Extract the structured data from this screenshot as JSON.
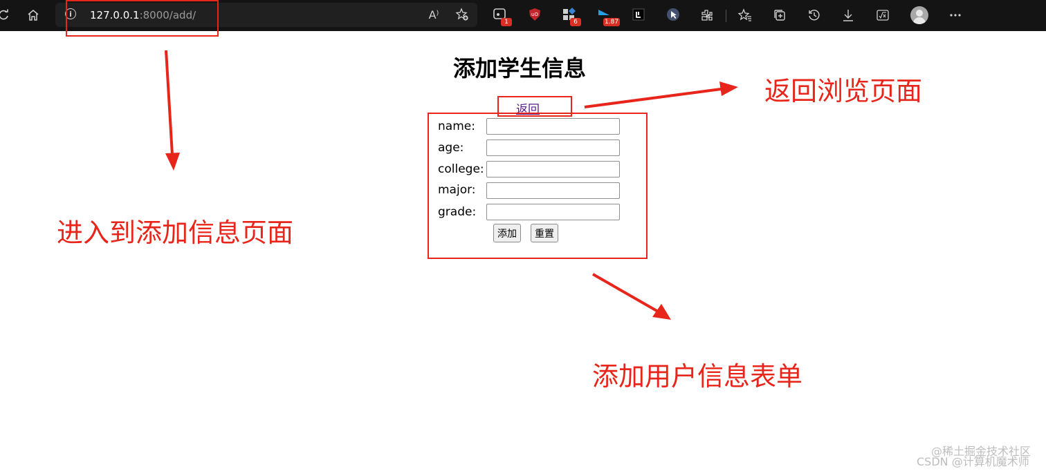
{
  "browser": {
    "address_host": "127.0.0.1",
    "address_path": ":8000/add/",
    "info_glyph": "i",
    "read_aloud_glyph": "A⁾",
    "extensions": [
      {
        "name": "ext-1-icon",
        "badge": "1",
        "color": "#cfcfcf"
      },
      {
        "name": "ublock-icon",
        "badge": "",
        "color": "#c0262a"
      },
      {
        "name": "ext-3-icon",
        "badge": "6",
        "color": "#3b82d6"
      },
      {
        "name": "ext-4-icon",
        "badge": "1.87",
        "color": "#28a0e0"
      },
      {
        "name": "ext-5-icon",
        "badge": "",
        "color": "#ffffff"
      },
      {
        "name": "cursor-ext-icon",
        "badge": "",
        "color": "#7a9ad8"
      }
    ]
  },
  "page": {
    "title": "添加学生信息",
    "back_link": "返回",
    "fields": [
      {
        "label": "name:",
        "value": ""
      },
      {
        "label": "age:",
        "value": ""
      },
      {
        "label": "college:",
        "value": ""
      },
      {
        "label": "major:",
        "value": ""
      },
      {
        "label": "grade:",
        "value": ""
      }
    ],
    "submit_label": "添加",
    "reset_label": "重置"
  },
  "annotations": {
    "enter_add_page": "进入到添加信息页面",
    "back_to_browse": "返回浏览页面",
    "add_user_form": "添加用户信息表单",
    "color": "#e8251a"
  },
  "watermark": {
    "line1": "@稀土掘金技术社区",
    "line2": "CSDN @计算机魔术师"
  }
}
